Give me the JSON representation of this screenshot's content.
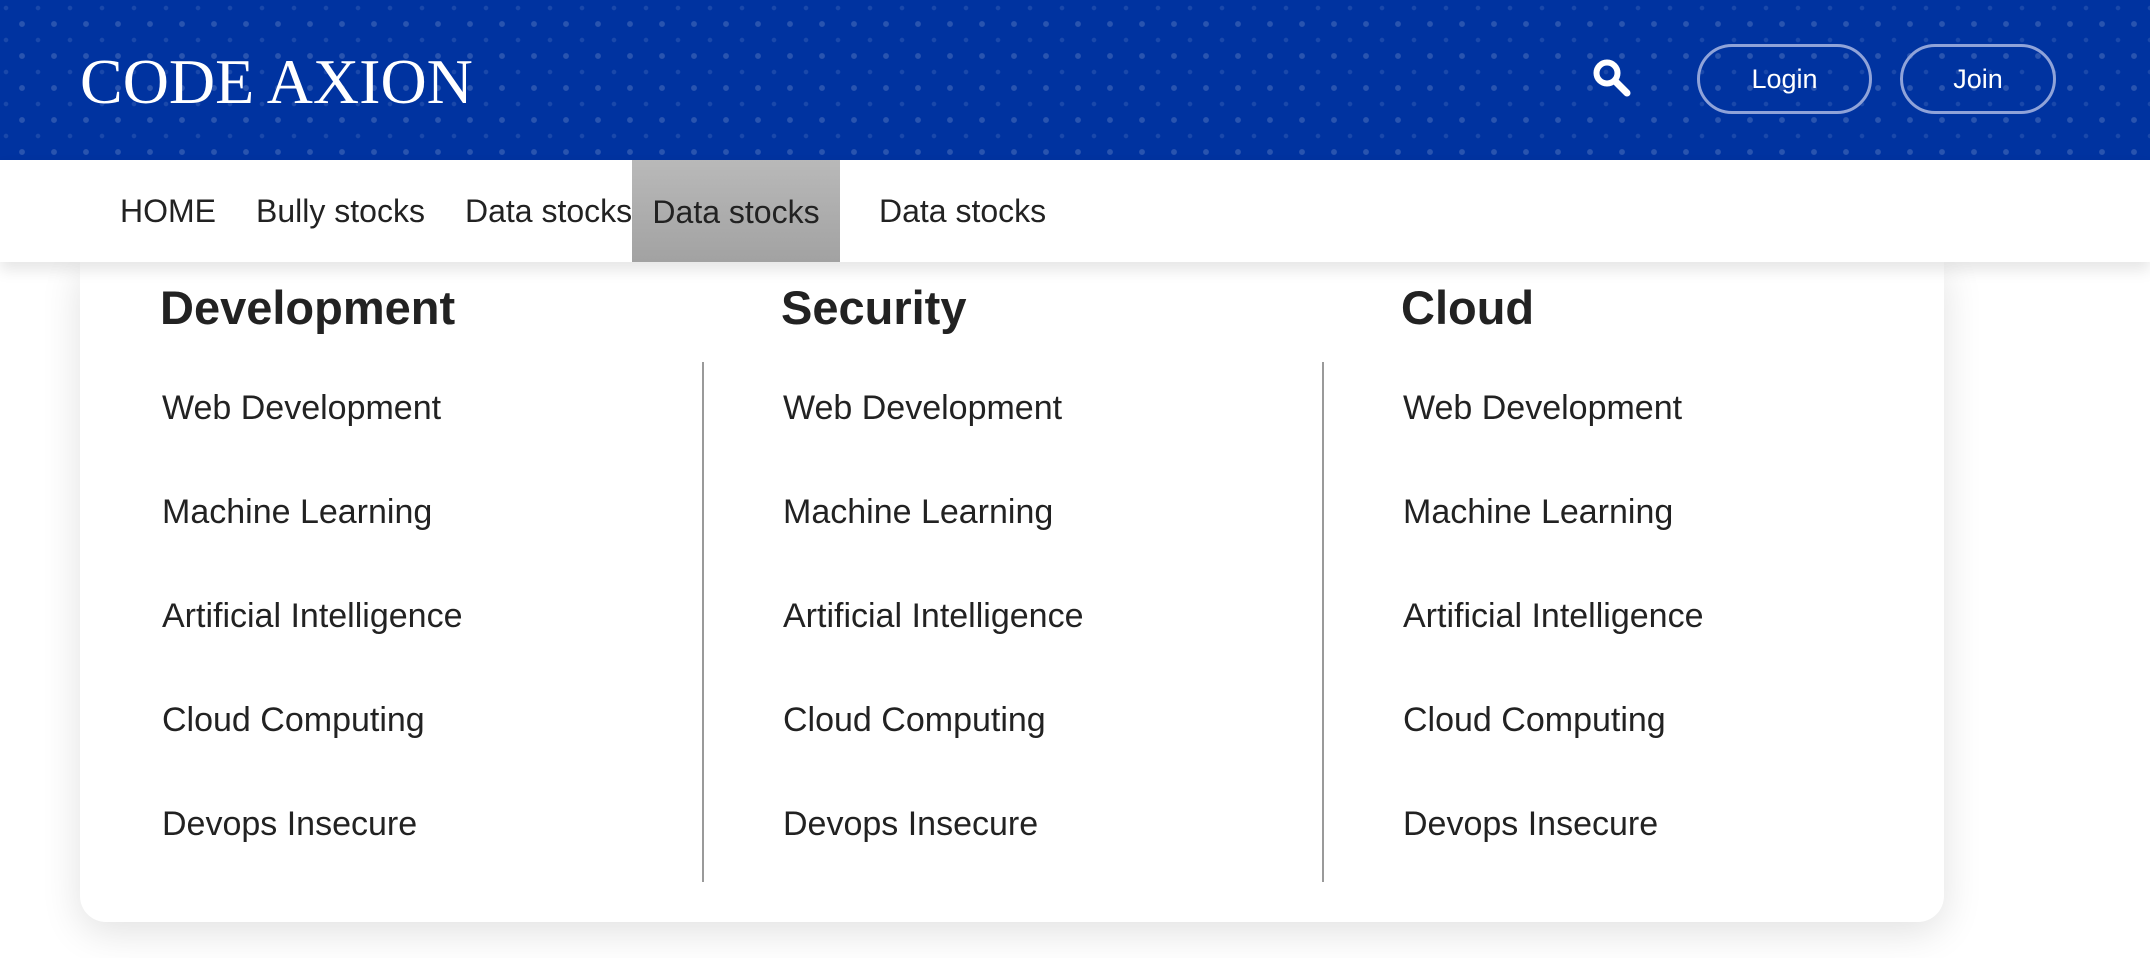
{
  "header": {
    "logo": "CODE AXION",
    "login_label": "Login",
    "join_label": "Join",
    "search_icon": "search-icon",
    "background_color": "#0033a0"
  },
  "nav": {
    "items": [
      {
        "label": "HOME"
      },
      {
        "label": "Bully stocks"
      },
      {
        "label": "Data stocks"
      },
      {
        "label": "Data stocks",
        "active": true
      },
      {
        "label": "Data stocks"
      }
    ],
    "active_color": "#aaaaaa"
  },
  "mega_menu": {
    "columns": [
      {
        "title": "Development",
        "links": [
          "Web Development",
          "Machine Learning",
          "Artificial Intelligence",
          "Cloud Computing",
          "Devops Insecure"
        ]
      },
      {
        "title": "Security",
        "links": [
          "Web Development",
          "Machine Learning",
          "Artificial Intelligence",
          "Cloud Computing",
          "Devops Insecure"
        ]
      },
      {
        "title": "Cloud",
        "links": [
          "Web Development",
          "Machine Learning",
          "Artificial Intelligence",
          "Cloud Computing",
          "Devops Insecure"
        ]
      }
    ]
  }
}
